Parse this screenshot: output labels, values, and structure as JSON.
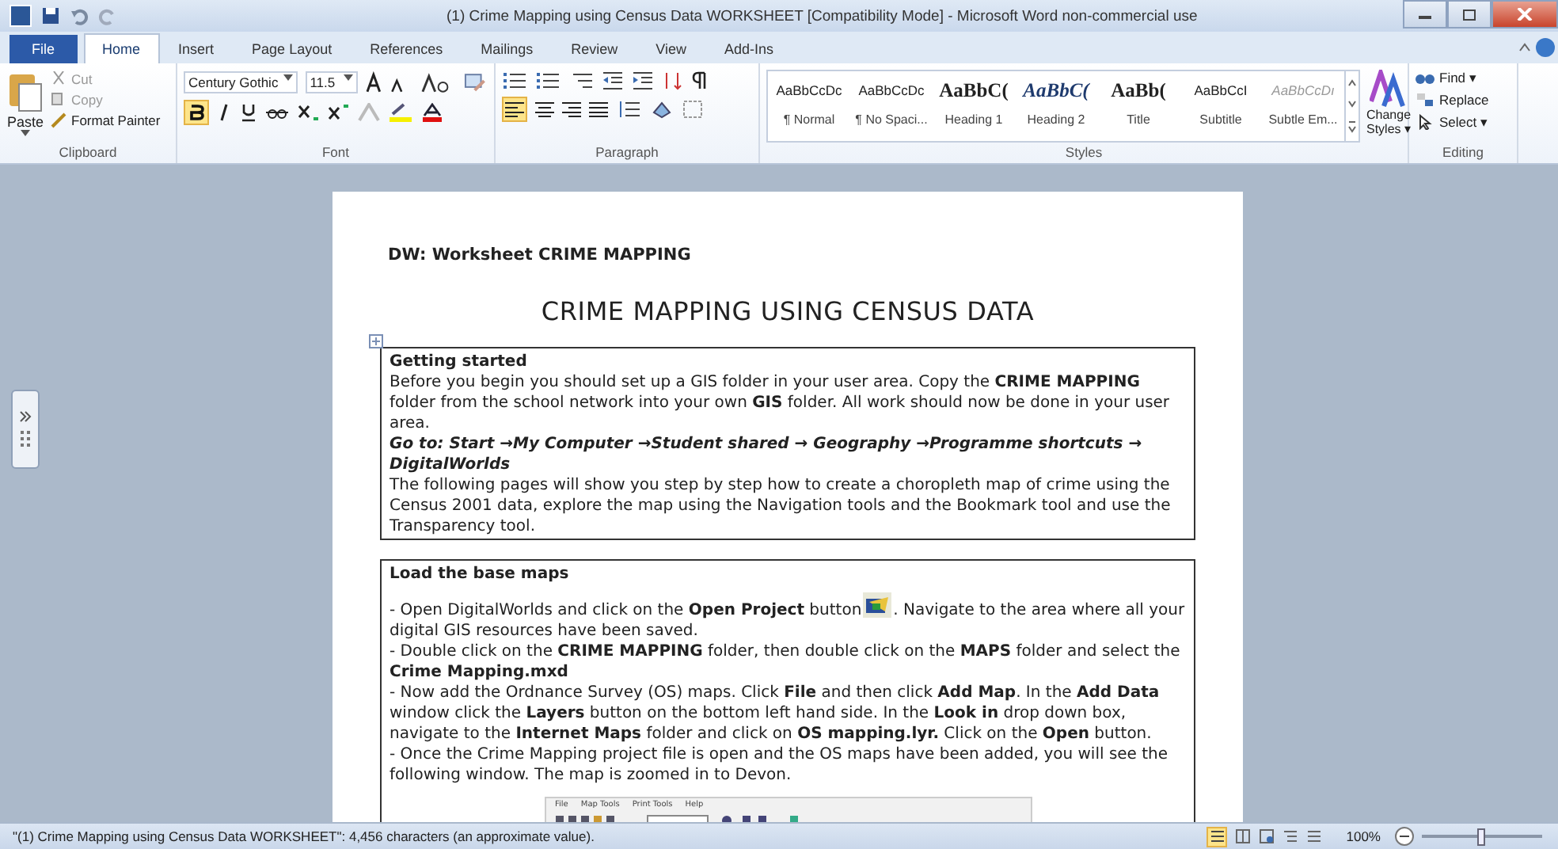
{
  "window": {
    "title": "(1) Crime Mapping using Census Data WORKSHEET [Compatibility Mode]  -  Microsoft Word non-commercial use"
  },
  "tabs": [
    {
      "label": "File",
      "selected": false,
      "kind": "file"
    },
    {
      "label": "Home",
      "selected": true,
      "kind": "tab"
    },
    {
      "label": "Insert",
      "selected": false,
      "kind": "tab"
    },
    {
      "label": "Page Layout",
      "selected": false,
      "kind": "tab"
    },
    {
      "label": "References",
      "selected": false,
      "kind": "tab"
    },
    {
      "label": "Mailings",
      "selected": false,
      "kind": "tab"
    },
    {
      "label": "Review",
      "selected": false,
      "kind": "tab"
    },
    {
      "label": "View",
      "selected": false,
      "kind": "tab"
    },
    {
      "label": "Add-Ins",
      "selected": false,
      "kind": "tab"
    }
  ],
  "clipboard": {
    "label": "Clipboard",
    "paste": "Paste",
    "cut": "Cut",
    "copy": "Copy",
    "format_painter": "Format Painter"
  },
  "font": {
    "label": "Font",
    "name": "Century Gothic",
    "size": "11.5",
    "bold_on": true
  },
  "paragraph": {
    "label": "Paragraph",
    "align_left_on": true
  },
  "styles": {
    "label": "Styles",
    "items": [
      {
        "preview": "AaBbCcDc",
        "name": "¶ Normal",
        "kind": "body"
      },
      {
        "preview": "AaBbCcDc",
        "name": "¶ No Spaci...",
        "kind": "body"
      },
      {
        "preview": "AaBbC(",
        "name": "Heading 1",
        "kind": "heading"
      },
      {
        "preview": "AaBbC(",
        "name": "Heading 2",
        "kind": "italic"
      },
      {
        "preview": "AaBb(",
        "name": "Title",
        "kind": "heading"
      },
      {
        "preview": "AaBbCcI",
        "name": "Subtitle",
        "kind": "body"
      },
      {
        "preview": "AaBbCcDı",
        "name": "Subtle Em...",
        "kind": "faint"
      }
    ],
    "change_styles": "Change Styles ▾"
  },
  "editing": {
    "label": "Editing",
    "find": "Find ▾",
    "replace": "Replace",
    "select": "Select ▾"
  },
  "document": {
    "header": "DW: Worksheet CRIME MAPPING",
    "heading": "CRIME MAPPING USING CENSUS DATA",
    "sections": [
      {
        "title": "Getting started",
        "paragraphs": [
          {
            "kind": "body",
            "text": "Before you begin you should set up a GIS folder in your user area. Copy the **CRIME MAPPING** folder from the school network into your own **GIS** folder. All work should now be done in your user area."
          },
          {
            "kind": "path",
            "text": "Go to: Start →My Computer →Student shared → Geography →Programme shortcuts → DigitalWorlds"
          },
          {
            "kind": "body",
            "text": "The following pages will show you step by step how to create a choropleth map of crime using the Census 2001 data, explore the map using the Navigation tools and the Bookmark tool and use the Transparency tool."
          }
        ]
      },
      {
        "title": "Load the base maps",
        "paragraphs": [
          {
            "kind": "icon",
            "text": "- Open DigitalWorlds and click on the **Open Project** button",
            "after": ". Navigate to the area where all your digital GIS resources have been saved."
          },
          {
            "kind": "body",
            "text": "- Double click on the **CRIME MAPPING** folder, then double click on the **MAPS** folder and select the **Crime Mapping.mxd**"
          },
          {
            "kind": "body",
            "text": "- Now add the Ordnance Survey (OS) maps. Click **File** and then click **Add Map**. In the **Add Data** window click the **Layers** button on the bottom left hand side. In the **Look in** drop down box, navigate to the **Internet Maps** folder and click on **OS mapping.lyr.** Click on the **Open** button."
          },
          {
            "kind": "body",
            "text": "- Once the Crime Mapping project file is open and the OS maps have been added, you will see the following window. The map is zoomed in to Devon."
          }
        ]
      }
    ],
    "screenshot_menu": [
      "File",
      "Map Tools",
      "Print Tools",
      "Help"
    ]
  },
  "status_bar": {
    "text": "\"(1) Crime Mapping using Census Data WORKSHEET\": 4,456 characters (an approximate value).",
    "zoom": "100%",
    "level": 0.5
  }
}
